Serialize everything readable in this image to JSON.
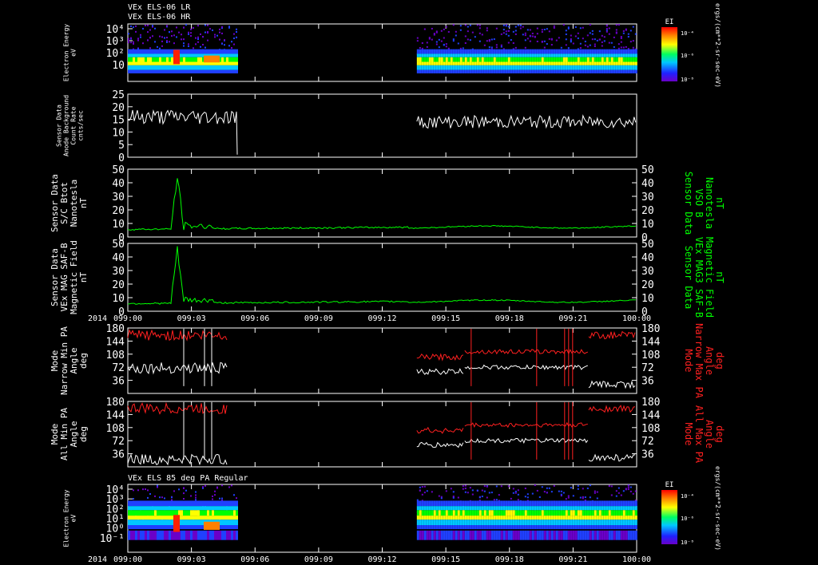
{
  "header": {
    "line1": "VEx ELS-06 LR",
    "line2": "VEx ELS-06 HR"
  },
  "colors": {
    "bg": "#000000",
    "white": "#ffffff",
    "green": "#00ff00",
    "red": "#ff2020",
    "black_line": "#ffffff"
  },
  "time_axis": {
    "year": "2014",
    "ticks": [
      "099:00",
      "099:03",
      "099:06",
      "099:09",
      "099:12",
      "099:15",
      "099:18",
      "099:21",
      "100:00"
    ]
  },
  "chart_data": [
    {
      "type": "heatmap",
      "id": "p1",
      "ylabel": [
        "Electron Energy",
        "eV"
      ],
      "y_scale": "log",
      "yticks": [
        "10⁴",
        "10³",
        "10²",
        "10"
      ],
      "colorbar": {
        "title": "EI",
        "ticks": [
          "10⁻⁴",
          "10⁻⁶",
          "10⁻⁸"
        ],
        "unit": "ergs/(cm**2-sr-sec-eV)"
      },
      "data_gap": [
        "099:05",
        "099:13"
      ]
    },
    {
      "type": "line",
      "id": "p2",
      "ylabel": [
        "Sensor Data",
        "Anode Background",
        "Count Rate",
        "cnts/sec"
      ],
      "ylim": [
        0,
        25
      ],
      "yticks": [
        "25",
        "20",
        "15",
        "10",
        "5",
        "0"
      ],
      "series": [
        {
          "color": "#ffffff",
          "mean_segment1": 16,
          "mean_segment2": 14
        }
      ]
    },
    {
      "type": "line",
      "id": "p3",
      "ylabel": [
        "Sensor Data",
        "S/C Btot",
        "Nanotesla",
        "nT"
      ],
      "ylabel_right": [
        "Sensor Data",
        "VSO B",
        "Nanotesla",
        "nT"
      ],
      "ylim": [
        0,
        50
      ],
      "yticks": [
        "50",
        "40",
        "30",
        "20",
        "10",
        "0"
      ],
      "peak": 41,
      "baseline": 5
    },
    {
      "type": "line",
      "id": "p4",
      "ylabel": [
        "Sensor Data",
        "VEx MAG SAF-B",
        "Magnetic Field",
        "nT"
      ],
      "ylabel_right": [
        "Sensor Data",
        "VEx MAG3 SAF-B",
        "Magnetic Field",
        "nT"
      ],
      "ylim": [
        0,
        50
      ],
      "yticks": [
        "50",
        "40",
        "30",
        "20",
        "10",
        "0"
      ],
      "peak": 42,
      "baseline": 5
    },
    {
      "type": "line",
      "id": "p5",
      "ylabel": [
        "Mode",
        "Narrow Min PA",
        "Angle",
        "deg"
      ],
      "ylabel_right": [
        "Mode",
        "Narrow Max PA",
        "Angle",
        "deg"
      ],
      "ylim": [
        0,
        180
      ],
      "yticks": [
        "180",
        "144",
        "108",
        "72",
        "36"
      ]
    },
    {
      "type": "line",
      "id": "p6",
      "ylabel": [
        "Mode",
        "All Min PA",
        "Angle",
        "deg"
      ],
      "ylabel_right": [
        "Mode",
        "All Max PA",
        "Angle",
        "deg"
      ],
      "ylim": [
        0,
        180
      ],
      "yticks": [
        "180",
        "144",
        "108",
        "72",
        "36"
      ]
    },
    {
      "type": "heatmap",
      "id": "p7",
      "title": "VEx ELS 85 deg PA Regular",
      "ylabel": [
        "Electron Energy",
        "eV"
      ],
      "y_scale": "log",
      "yticks": [
        "10⁴",
        "10³",
        "10²",
        "10¹",
        "10⁰",
        "10⁻¹"
      ],
      "colorbar": {
        "title": "EI",
        "ticks": [
          "10⁻⁴",
          "10⁻⁶",
          "10⁻⁸"
        ],
        "unit": "ergs/(cm**2-sr-sec-eV)"
      }
    }
  ]
}
